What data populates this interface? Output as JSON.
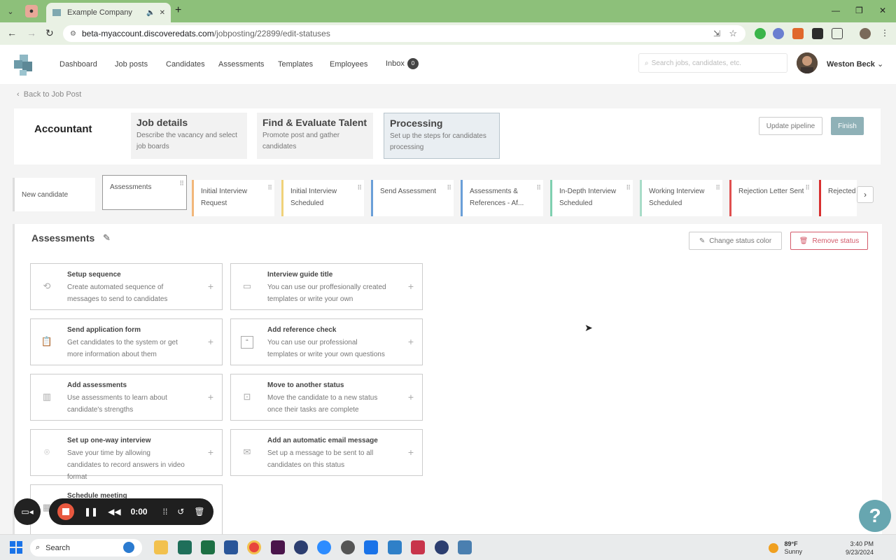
{
  "browser": {
    "tab_title": "Example Company",
    "url_host": "beta-myaccount.discoveredats.com",
    "url_path": "/jobposting/22899/edit-statuses"
  },
  "header": {
    "nav": [
      "Dashboard",
      "Job posts",
      "Candidates",
      "Assessments",
      "Templates",
      "Employees",
      "Inbox"
    ],
    "inbox_count": "0",
    "search_placeholder": "Search jobs, candidates, etc.",
    "user_name": "Weston Beck"
  },
  "page": {
    "back_label": "Back to Job Post",
    "job_title": "Accountant",
    "steps": [
      {
        "title": "Job details",
        "desc": "Describe the vacancy and select job boards"
      },
      {
        "title": "Find & Evaluate Talent",
        "desc": "Promote post and gather candidates"
      },
      {
        "title": "Processing",
        "desc": "Set up the steps for candidates processing"
      }
    ],
    "update_label": "Update pipeline",
    "finish_label": "Finish"
  },
  "pipeline": [
    {
      "label": "New candidate",
      "color": "#dddddd"
    },
    {
      "label": "Assessments",
      "color": "#999999"
    },
    {
      "label": "Initial Interview Request",
      "color": "#f2b77a"
    },
    {
      "label": "Initial Interview Scheduled",
      "color": "#f0d27a"
    },
    {
      "label": "Send Assessment",
      "color": "#6a9fd8"
    },
    {
      "label": "Assessments & References - Af...",
      "color": "#6a9fd8"
    },
    {
      "label": "In-Depth Interview Scheduled",
      "color": "#7fd0b0"
    },
    {
      "label": "Working Interview Scheduled",
      "color": "#a8dcc8"
    },
    {
      "label": "Rejection Letter Sent",
      "color": "#e05050"
    },
    {
      "label": "Rejected",
      "color": "#d83030"
    }
  ],
  "panel": {
    "title": "Assessments",
    "change_color_label": "Change status color",
    "remove_label": "Remove status"
  },
  "actions": [
    {
      "title": "Setup sequence",
      "desc": "Create automated sequence of messages to send to candidates",
      "icon": "sequence-icon"
    },
    {
      "title": "Interview guide title",
      "desc": "You can use our proffesionally created templates or write your own",
      "icon": "chat-icon"
    },
    {
      "title": "Send application form",
      "desc": "Get candidates to the system or get more information about them",
      "icon": "clipboard-icon"
    },
    {
      "title": "Add reference check",
      "desc": "You can use our professional templates or write your own questions",
      "icon": "quote-icon"
    },
    {
      "title": "Add assessments",
      "desc": "Use assessments to learn about candidate's strengths",
      "icon": "chart-icon"
    },
    {
      "title": "Move to another status",
      "desc": "Move the candidate to a new status once their tasks are complete",
      "icon": "move-icon"
    },
    {
      "title": "Set up one-way interview",
      "desc": "Save your time by allowing candidates to record answers in video format",
      "icon": "location-icon"
    },
    {
      "title": "Add an automatic email message",
      "desc": "Set up a message to be sent to all candidates on this status",
      "icon": "mail-icon"
    },
    {
      "title": "Schedule meeting",
      "desc": "",
      "icon": "calendar-icon"
    }
  ],
  "recorder": {
    "time": "0:00"
  },
  "taskbar": {
    "search_label": "Search",
    "temperature": "89°F",
    "weather": "Sunny",
    "time": "3:40 PM",
    "date": "9/23/2024"
  }
}
